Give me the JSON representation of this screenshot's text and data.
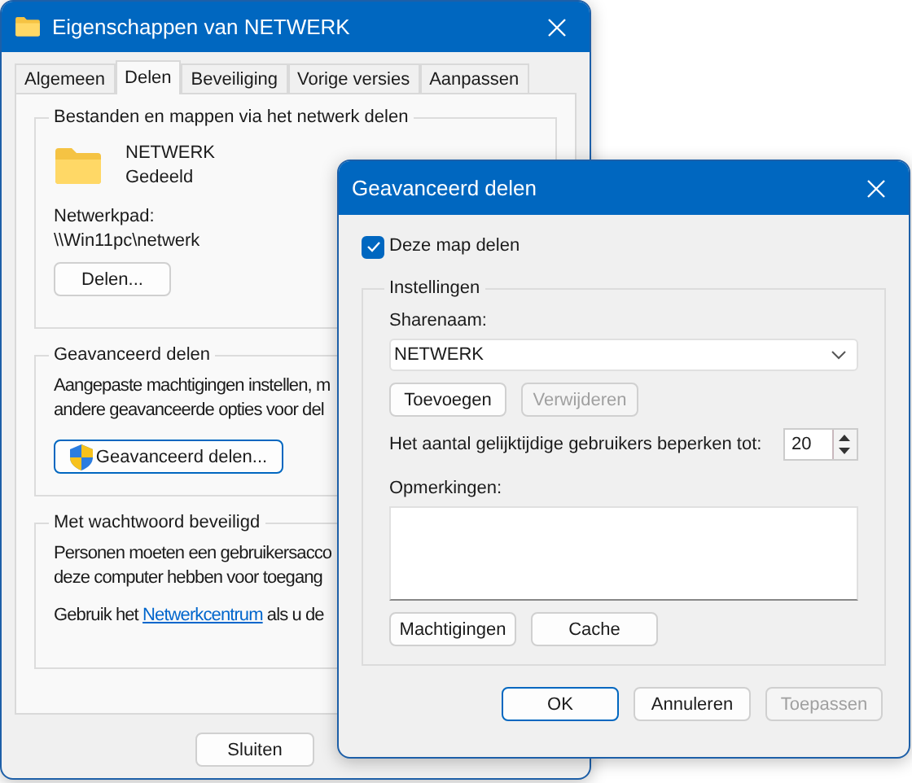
{
  "main_window": {
    "title": "Eigenschappen van NETWERK",
    "tabs": [
      {
        "label": "Algemeen",
        "selected": false
      },
      {
        "label": "Delen",
        "selected": true
      },
      {
        "label": "Beveiliging",
        "selected": false
      },
      {
        "label": "Vorige versies",
        "selected": false
      },
      {
        "label": "Aanpassen",
        "selected": false
      }
    ],
    "sharing_group": {
      "legend": "Bestanden en mappen via het netwerk delen",
      "name": "NETWERK",
      "status": "Gedeeld",
      "path_label": "Netwerkpad:",
      "path": "\\\\Win11pc\\netwerk",
      "button": "Delen..."
    },
    "advanced_group": {
      "legend": "Geavanceerd delen",
      "lines": [
        "Aangepaste machtigingen instellen, m",
        "andere geavanceerde opties voor del"
      ],
      "button": "Geavanceerd delen..."
    },
    "password_group": {
      "legend": "Met wachtwoord beveiligd",
      "lines": [
        "Personen moeten een gebruikersacco",
        "deze computer hebben voor toegang"
      ],
      "note_before": "Gebruik het ",
      "note_link": "Netwerkcentrum",
      "note_after": " als u de"
    },
    "buttons": [
      {
        "label": "Sluiten",
        "disabled": false
      }
    ]
  },
  "dialog": {
    "title": "Geavanceerd delen",
    "share_checkbox": {
      "label": "Deze map delen",
      "checked": true
    },
    "settings": {
      "legend": "Instellingen",
      "share_name_label": "Sharenaam:",
      "share_name": "NETWERK",
      "name_buttons": [
        {
          "label": "Toevoegen",
          "disabled": false
        },
        {
          "label": "Verwijderen",
          "disabled": true
        }
      ],
      "limit_label": "Het aantal gelijktijdige gebruikers beperken tot:",
      "limit_value": "20",
      "comments_label": "Opmerkingen:",
      "buttons": [
        {
          "label": "Machtigingen",
          "disabled": false
        },
        {
          "label": "Cache",
          "disabled": false
        }
      ]
    },
    "buttons": [
      {
        "label": "OK",
        "disabled": false,
        "default": true
      },
      {
        "label": "Annuleren",
        "disabled": false,
        "default": false
      },
      {
        "label": "Toepassen",
        "disabled": true,
        "default": false
      }
    ]
  }
}
